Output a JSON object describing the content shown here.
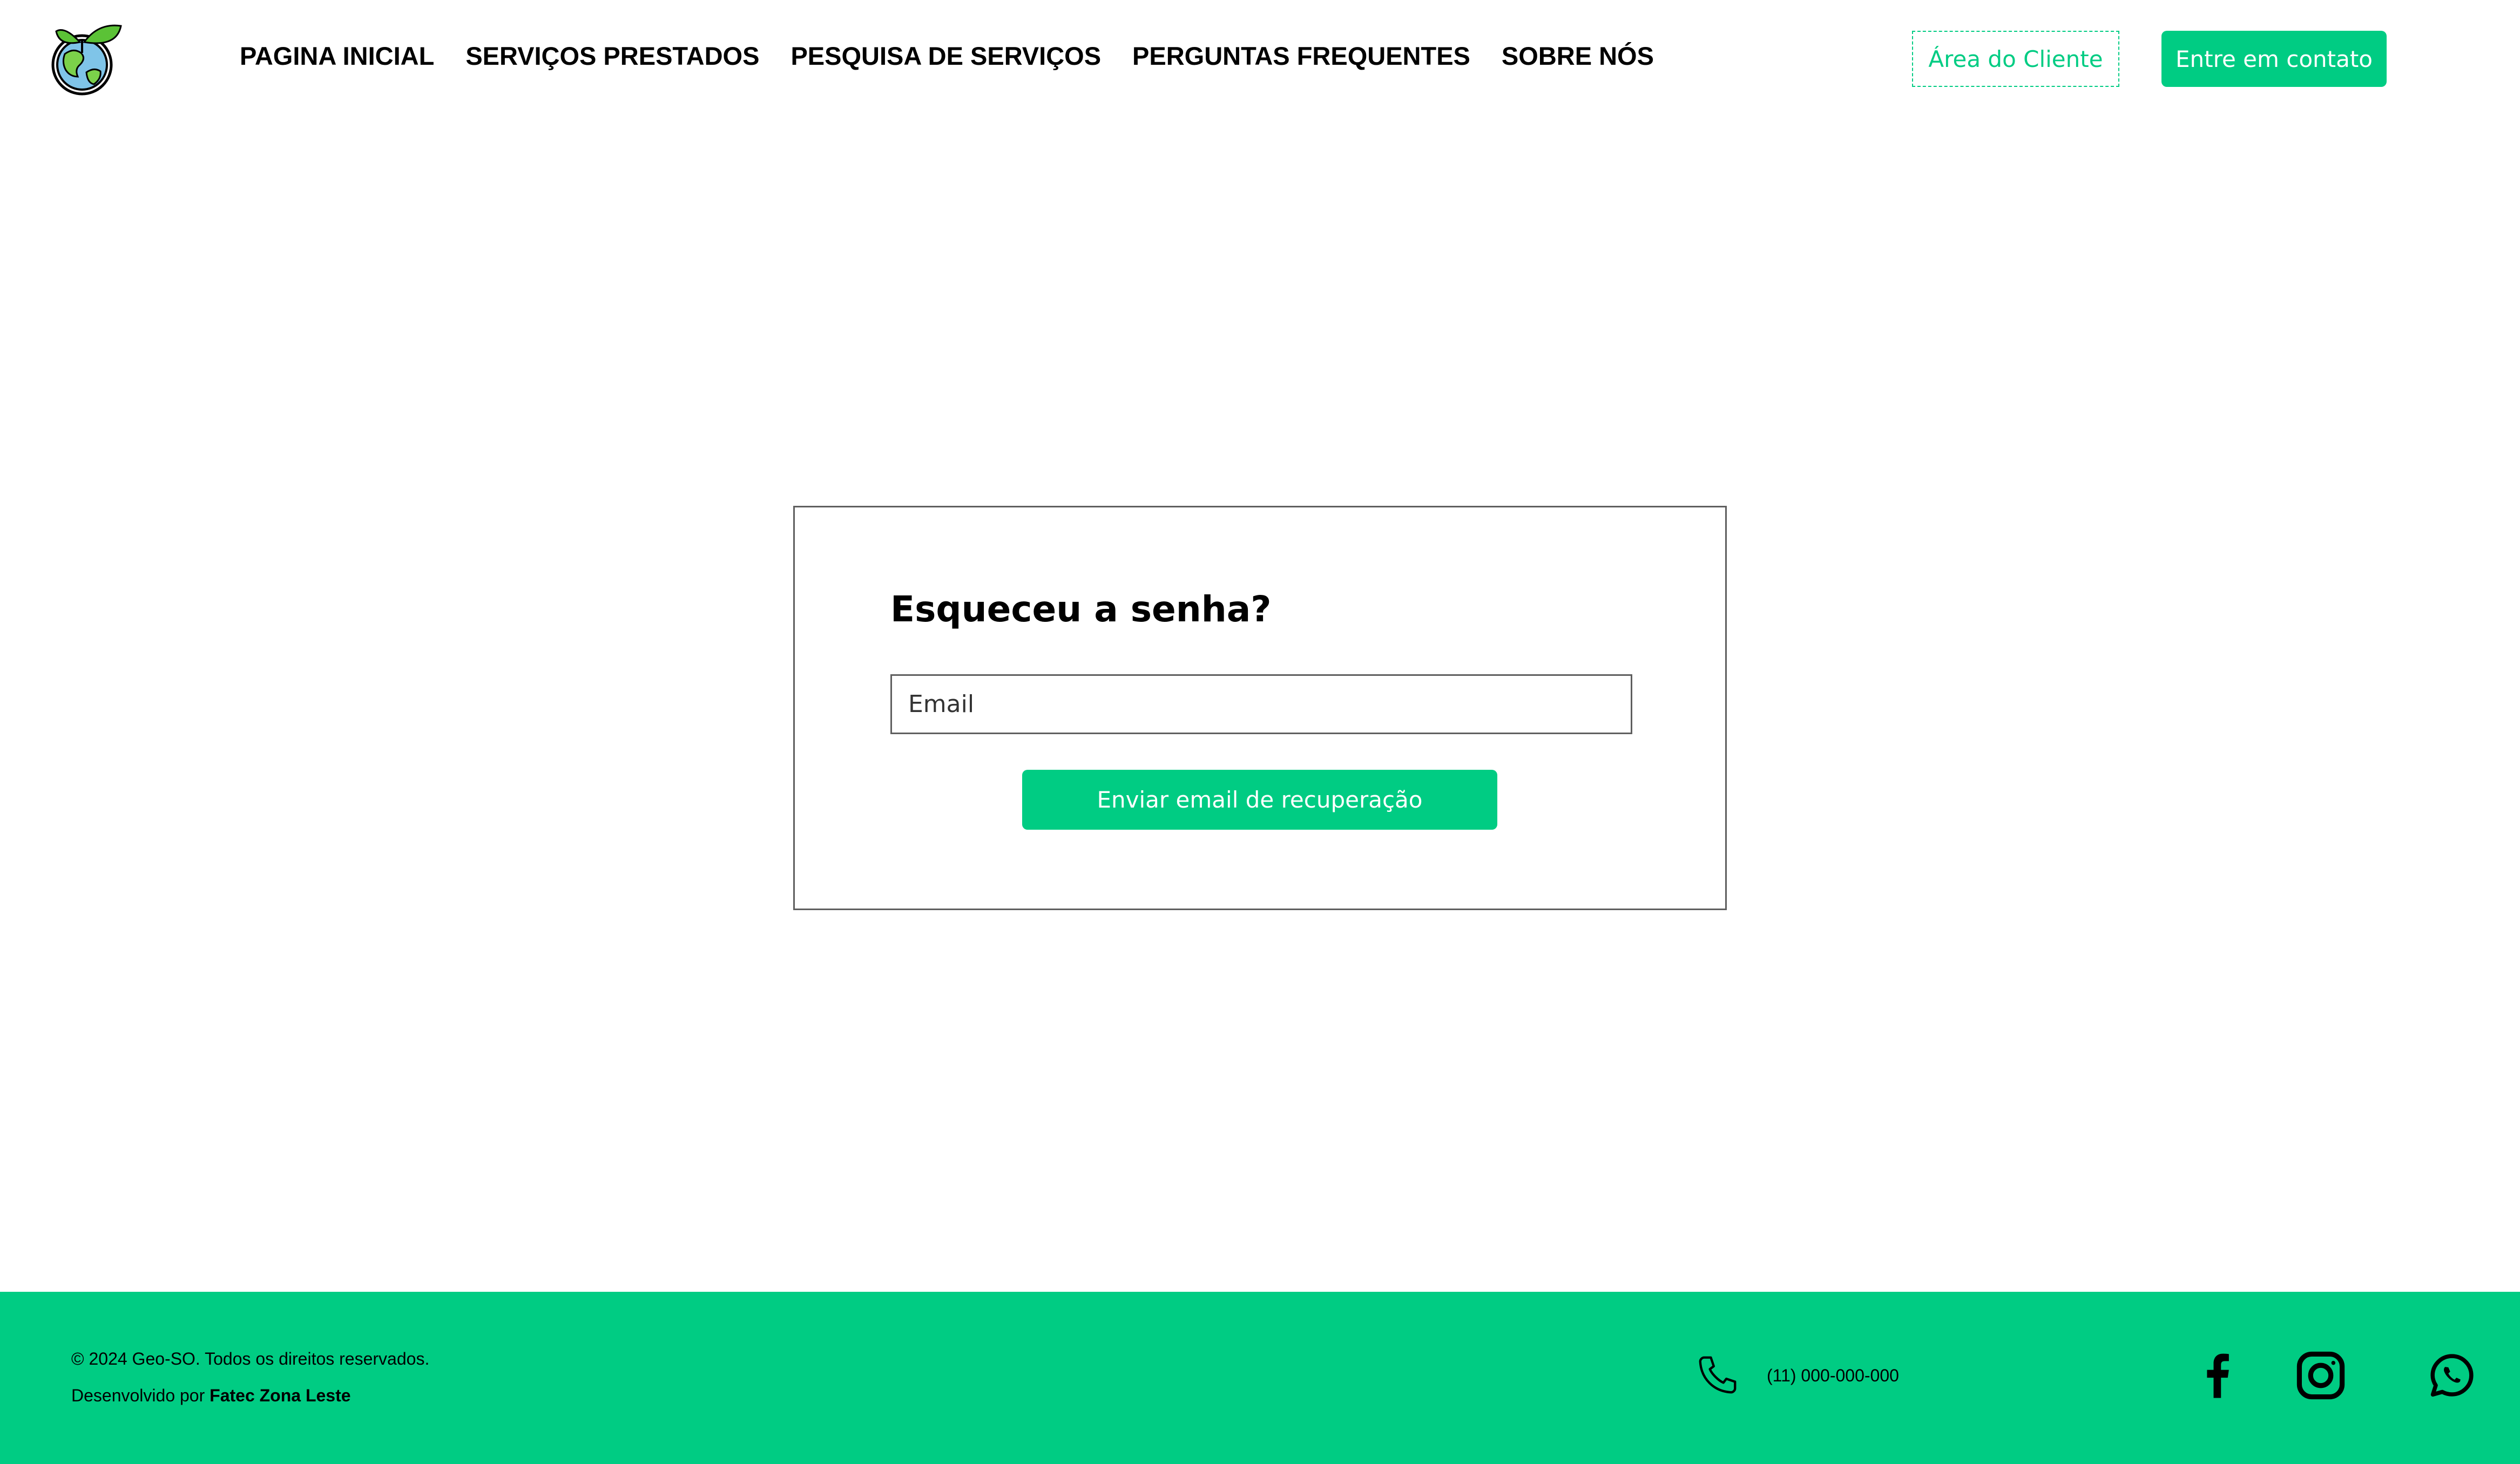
{
  "header": {
    "nav": [
      "PAGINA INICIAL",
      "SERVIÇOS PRESTADOS",
      "PESQUISA DE SERVIÇOS",
      "PERGUNTAS FREQUENTES",
      "SOBRE NÓS"
    ],
    "client_area_label": "Área do Cliente",
    "contact_label": "Entre em contato"
  },
  "recovery": {
    "title": "Esqueceu a senha?",
    "email_placeholder": "Email",
    "email_value": "",
    "submit_label": "Enviar email de recuperação"
  },
  "footer": {
    "copyright": "© 2024 Geo-SO. Todos os direitos reservados.",
    "credit_prefix": "Desenvolvido por",
    "credit_name": "Fatec Zona Leste",
    "phone": "(11) 000-000-000",
    "social_icons": [
      "facebook-icon",
      "instagram-icon",
      "whatsapp-icon"
    ]
  },
  "colors": {
    "accent": "#00cc83",
    "border": "#5f5f5f",
    "text": "#000000"
  }
}
